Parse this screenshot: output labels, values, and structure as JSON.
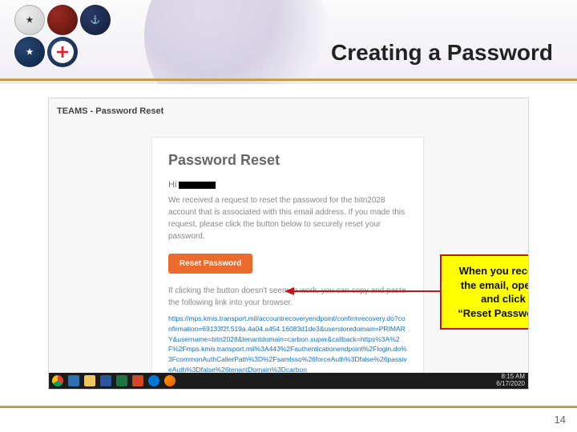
{
  "slide": {
    "title": "Creating a Password",
    "page_number": "14"
  },
  "email": {
    "subject": "TEAMS - Password Reset",
    "heading": "Password Reset",
    "greeting_prefix": "Hi ",
    "body": "We received a request to reset the password for the bitn2028 account that is associated with this email address. If you made this request, please click the button below to securely reset your password.",
    "button_label": "Reset Password",
    "alt_instruction": "If clicking the button doesn't seem to work, you can copy and paste the following link into your browser.",
    "url": "https://mps.kmis.transport.mil/accountrecoveryendpoint/confirmrecovery.do?confirmation=69133f2f.519a.4a04.a454.16083d1de3&userstoredomain=PRIMARY&username=bitn2028&tenantdomain=carbon.super&callback=https%3A%2F%2Fmps.kmis.transport.mil%3A443%2Fauthenticationendpoint%2Flogin.do%3FcommonAuthCallerPath%3D%2Fsamlsso%26forceAuth%3Dfalse%26passiveAuth%3Dfalse%26tenantDomain%3Dcarbon"
  },
  "callout": {
    "line1": "When you receive",
    "line2": "the email, open it",
    "line3": "and click",
    "line4": "“Reset Password”"
  },
  "taskbar": {
    "time": "8:15 AM",
    "date": "6/17/2020"
  }
}
